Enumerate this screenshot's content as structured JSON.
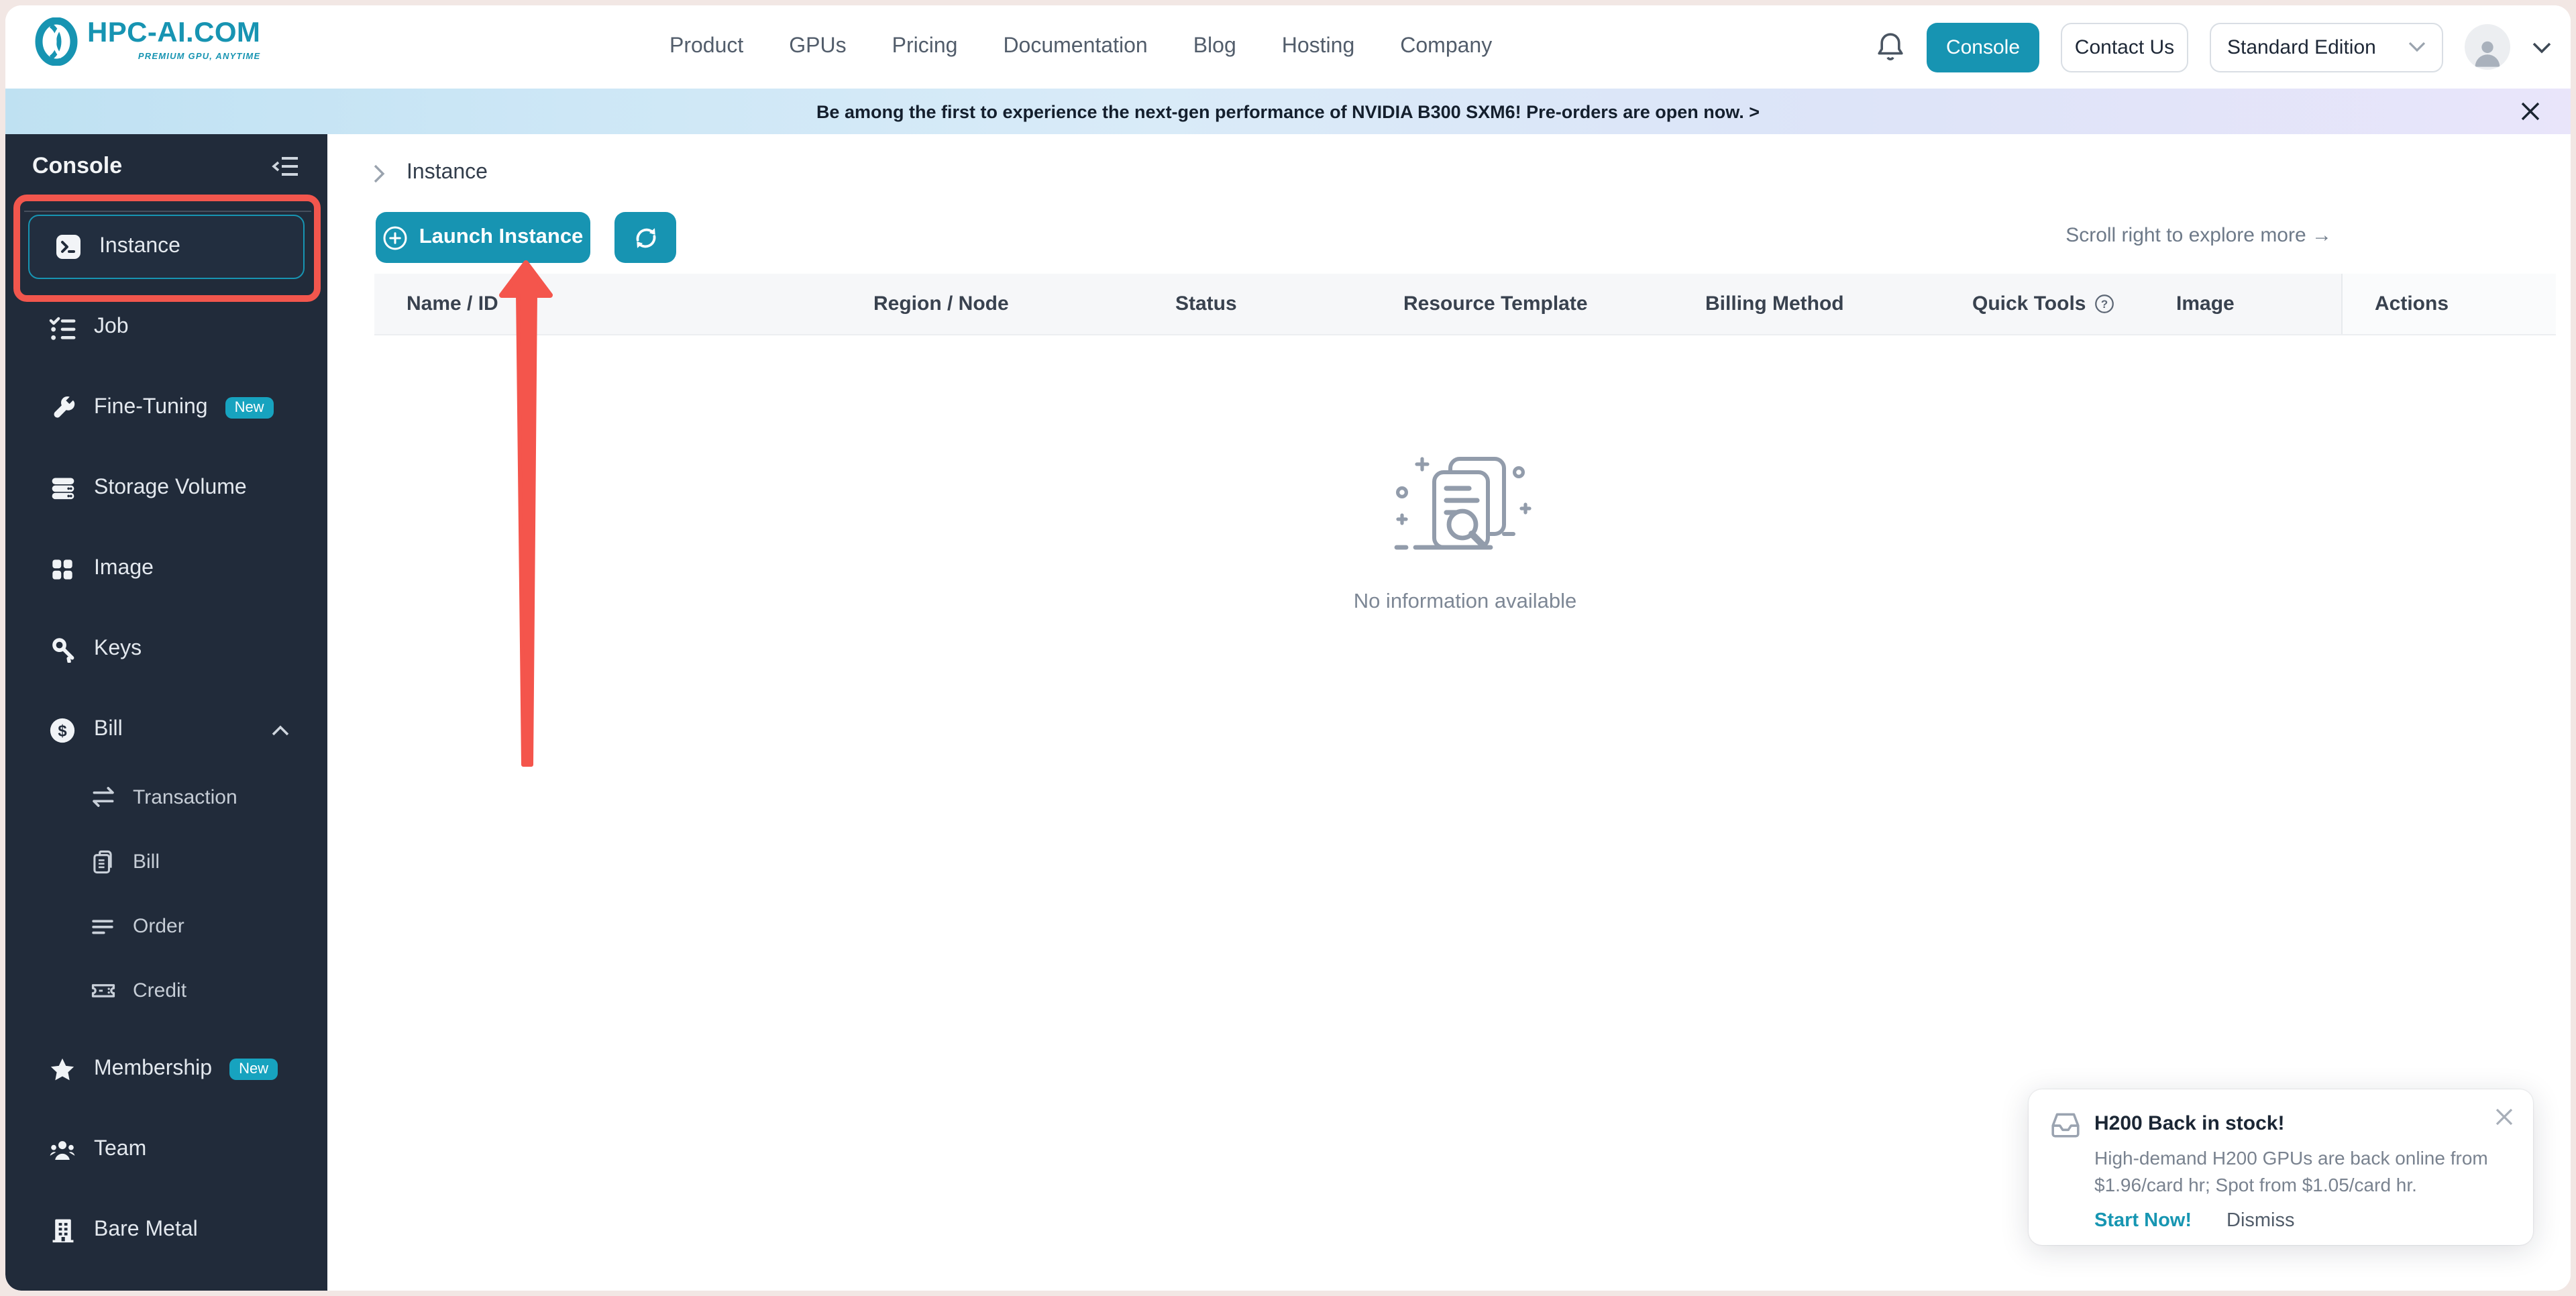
{
  "header": {
    "logo_title": "HPC-AI.COM",
    "logo_tagline": "PREMIUM GPU, ANYTIME",
    "nav": [
      "Product",
      "GPUs",
      "Pricing",
      "Documentation",
      "Blog",
      "Hosting",
      "Company"
    ],
    "console_button": "Console",
    "contact_button": "Contact Us",
    "edition_select": "Standard Edition"
  },
  "banner": {
    "text": "Be among the first to experience the next-gen performance of NVIDIA B300 SXM6! Pre-orders are open now. >"
  },
  "sidebar": {
    "title": "Console",
    "items": [
      {
        "label": "Instance"
      },
      {
        "label": "Job"
      },
      {
        "label": "Fine-Tuning",
        "badge": "New"
      },
      {
        "label": "Storage Volume"
      },
      {
        "label": "Image"
      },
      {
        "label": "Keys"
      },
      {
        "label": "Bill"
      },
      {
        "label": "Transaction"
      },
      {
        "label": "Bill"
      },
      {
        "label": "Order"
      },
      {
        "label": "Credit"
      },
      {
        "label": "Membership",
        "badge": "New"
      },
      {
        "label": "Team"
      },
      {
        "label": "Bare Metal"
      }
    ]
  },
  "main": {
    "breadcrumb": "Instance",
    "launch_button": "Launch Instance",
    "scroll_hint": "Scroll right to explore more →",
    "table_headers": [
      "Name / ID",
      "Region / Node",
      "Status",
      "Resource Template",
      "Billing Method",
      "Quick Tools",
      "Image",
      "Actions"
    ],
    "empty_text": "No information available"
  },
  "toast": {
    "title": "H200 Back in stock!",
    "body": "High-demand H200 GPUs are back online from $1.96/card hr; Spot from $1.05/card hr.",
    "primary": "Start Now!",
    "secondary": "Dismiss"
  },
  "colors": {
    "accent": "#1794b2",
    "sidebar_bg": "#212b3a",
    "annotation_red": "#f2564d",
    "banner_left": "#bfe1f2",
    "banner_right": "#e9e5fa"
  }
}
